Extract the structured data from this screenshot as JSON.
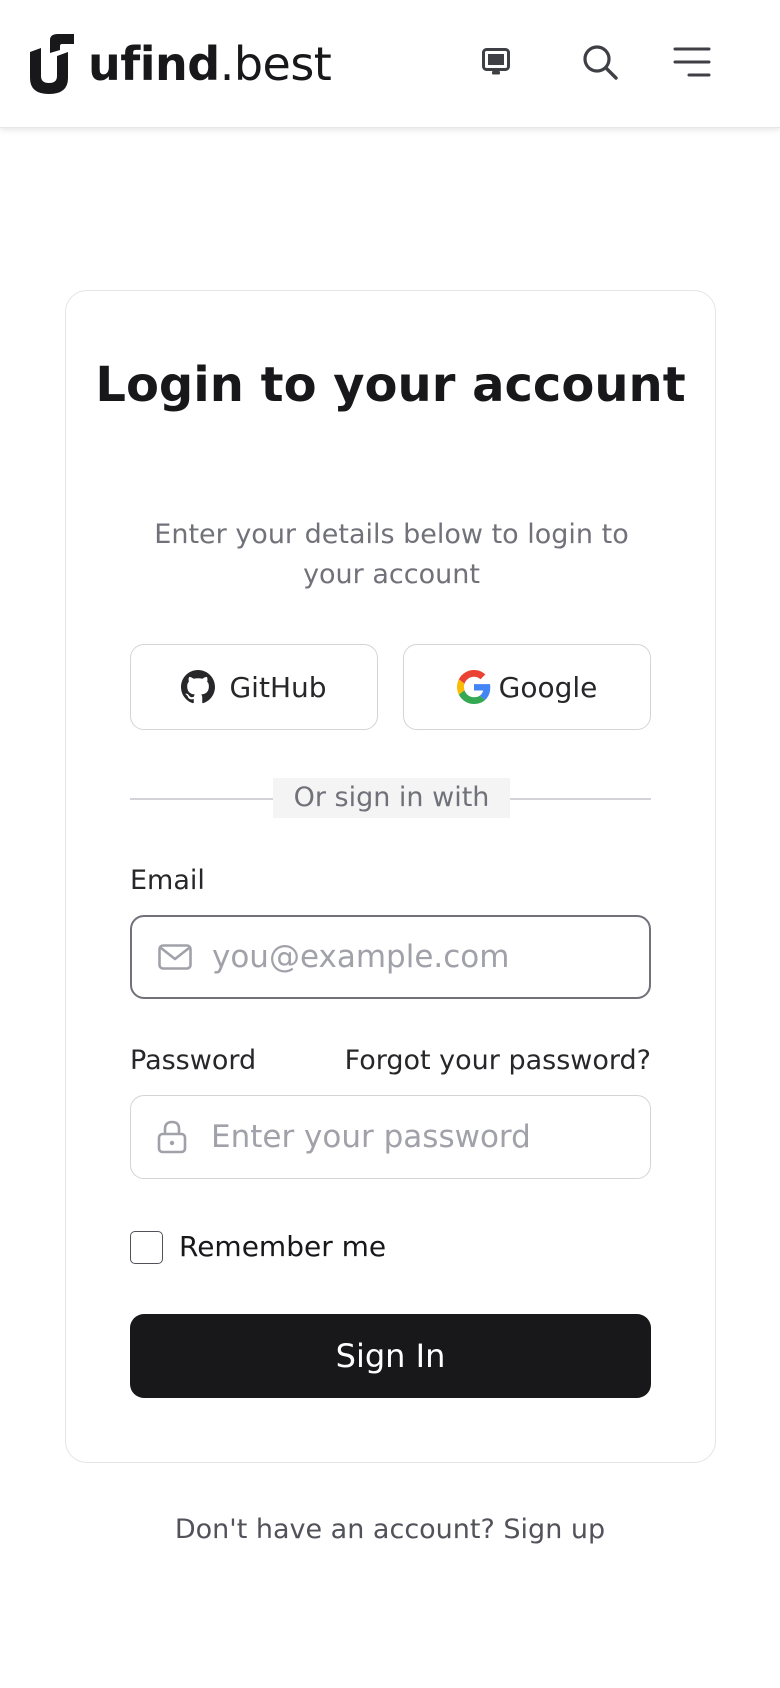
{
  "header": {
    "brand_name": "ufind",
    "brand_tld": ".best",
    "icons": [
      "monitor-icon",
      "search-icon",
      "menu-icon"
    ]
  },
  "login": {
    "title": "Login to your account",
    "subtitle": "Enter your details below to login to your account",
    "github_label": "GitHub",
    "google_label": "Google",
    "divider_text": "Or sign in with",
    "email_label": "Email",
    "email_placeholder": "you@example.com",
    "email_value": "",
    "password_label": "Password",
    "forgot_label": "Forgot your password?",
    "password_placeholder": "Enter your password",
    "password_value": "",
    "remember_label": "Remember me",
    "remember_checked": false,
    "signin_label": "Sign In"
  },
  "footer": {
    "prompt": "Don't have an account?",
    "signup_label": "Sign up"
  },
  "colors": {
    "primary": "#18181b",
    "muted_text": "#71717a",
    "border": "#d4d4d8",
    "google_blue": "#4285F4",
    "google_red": "#EA4335",
    "google_yellow": "#FBBC05",
    "google_green": "#34A853"
  }
}
